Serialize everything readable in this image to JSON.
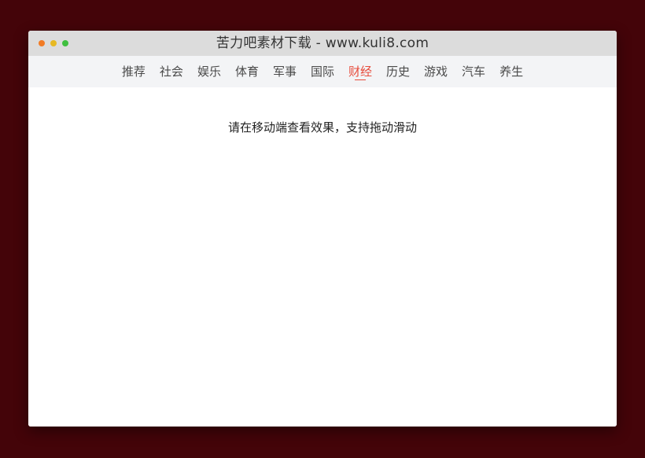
{
  "window": {
    "title": "苦力吧素材下载 - www.kuli8.com",
    "buttons": [
      {
        "name": "close",
        "color": "#f27b24"
      },
      {
        "name": "minimize",
        "color": "#e7b923"
      },
      {
        "name": "maximize",
        "color": "#3fbf3f"
      }
    ]
  },
  "nav": {
    "items": [
      {
        "label": "推荐"
      },
      {
        "label": "社会"
      },
      {
        "label": "娱乐"
      },
      {
        "label": "体育"
      },
      {
        "label": "军事"
      },
      {
        "label": "国际"
      },
      {
        "label": "财经",
        "active": true
      },
      {
        "label": "历史"
      },
      {
        "label": "游戏"
      },
      {
        "label": "汽车"
      },
      {
        "label": "养生"
      }
    ],
    "active_color": "#e74c3c"
  },
  "content": {
    "hint": "请在移动端查看效果，支持拖动滑动"
  },
  "colors": {
    "page_background": "#440409"
  }
}
